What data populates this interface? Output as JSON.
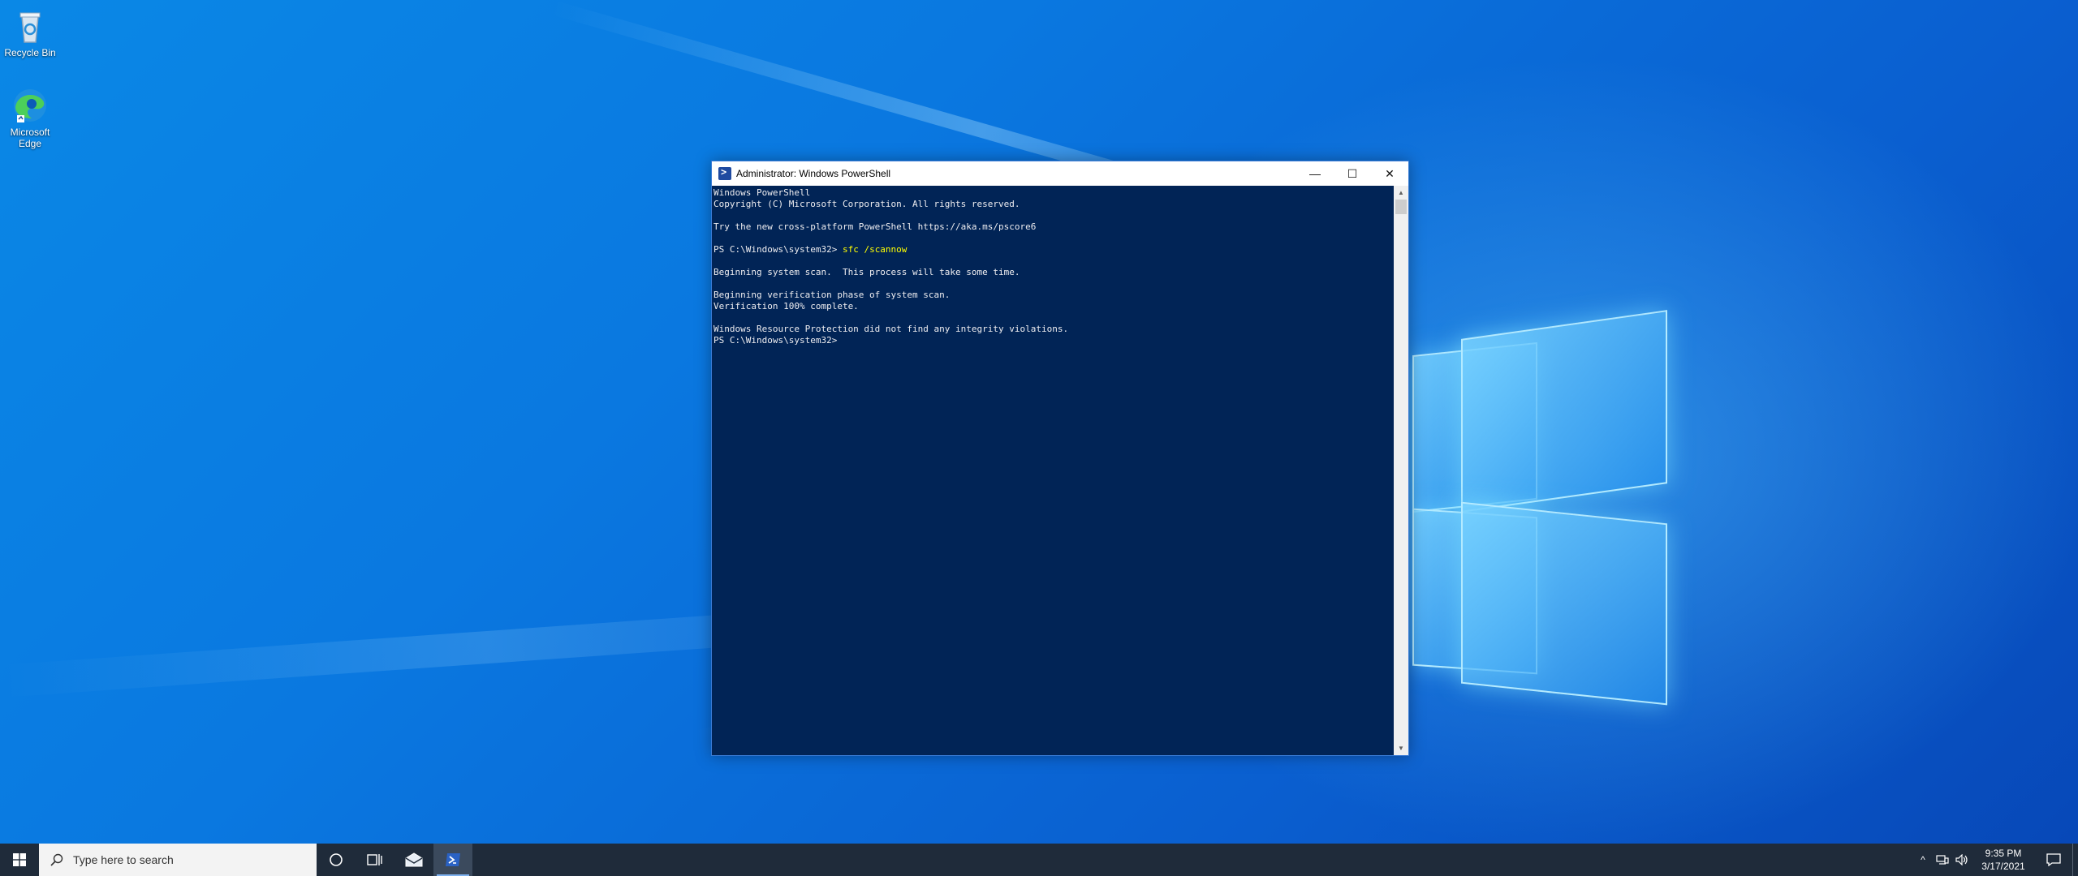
{
  "desktop": {
    "icons": [
      {
        "label": "Recycle Bin",
        "icon": "recycle-bin-icon"
      },
      {
        "label": "Microsoft Edge",
        "icon": "edge-icon"
      }
    ]
  },
  "window": {
    "title": "Administrator: Windows PowerShell",
    "buttons": {
      "minimize": "—",
      "maximize": "☐",
      "close": "✕"
    },
    "console": {
      "line1": "Windows PowerShell",
      "line2": "Copyright (C) Microsoft Corporation. All rights reserved.",
      "line3": "Try the new cross-platform PowerShell https://aka.ms/pscore6",
      "prompt": "PS C:\\Windows\\system32> ",
      "command": "sfc /scannow",
      "line5": "Beginning system scan.  This process will take some time.",
      "line6": "Beginning verification phase of system scan.",
      "line7": "Verification 100% complete.",
      "line8": "Windows Resource Protection did not find any integrity violations.",
      "prompt2": "PS C:\\Windows\\system32>"
    }
  },
  "taskbar": {
    "search_placeholder": "Type here to search",
    "clock_time": "9:35 PM",
    "clock_date": "3/17/2021",
    "tray_chevron": "^"
  }
}
